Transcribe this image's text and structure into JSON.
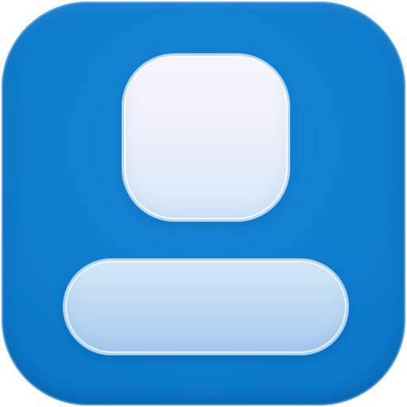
{
  "icon": {
    "name": "contact-profile-icon",
    "colors": {
      "background": "#0b78c8",
      "background_light": "#1787d6",
      "head_fill": "#eef0fb",
      "body_fill": "#bcd9f3",
      "highlight": "#d2e8fc"
    }
  }
}
